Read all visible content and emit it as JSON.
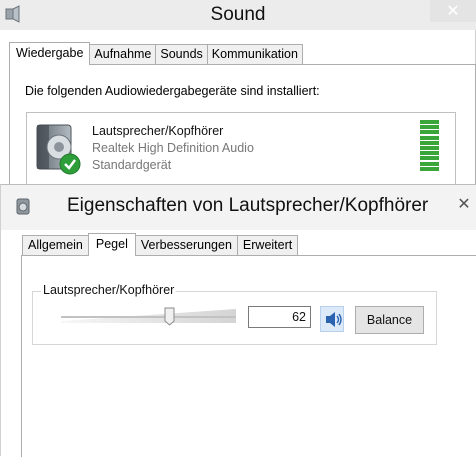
{
  "sound_window": {
    "title": "Sound",
    "close_glyph": "✕",
    "tabs": [
      {
        "label": "Wiedergabe",
        "active": true
      },
      {
        "label": "Aufnahme",
        "active": false
      },
      {
        "label": "Sounds",
        "active": false
      },
      {
        "label": "Kommunikation",
        "active": false
      }
    ],
    "description": "Die folgenden Audiowiedergabegeräte sind installiert:",
    "device": {
      "name": "Lautsprecher/Kopfhörer",
      "driver": "Realtek High Definition Audio",
      "status": "Standardgerät",
      "icon": "speaker-icon",
      "default_badge_icon": "checkmark-icon",
      "level_meter_bars": 10,
      "level_color": "#3aa63a"
    }
  },
  "properties_window": {
    "title": "Eigenschaften von Lautsprecher/Kopfhörer",
    "close_glyph": "✕",
    "tabs": [
      {
        "label": "Allgemein",
        "active": false
      },
      {
        "label": "Pegel",
        "active": true
      },
      {
        "label": "Verbesserungen",
        "active": false
      },
      {
        "label": "Erweitert",
        "active": false
      }
    ],
    "level_group": {
      "label": "Lautsprecher/Kopfhörer",
      "volume_value": "62",
      "volume_fraction": 0.62,
      "mute_icon": "speaker-volume-icon",
      "balance_label": "Balance"
    }
  }
}
